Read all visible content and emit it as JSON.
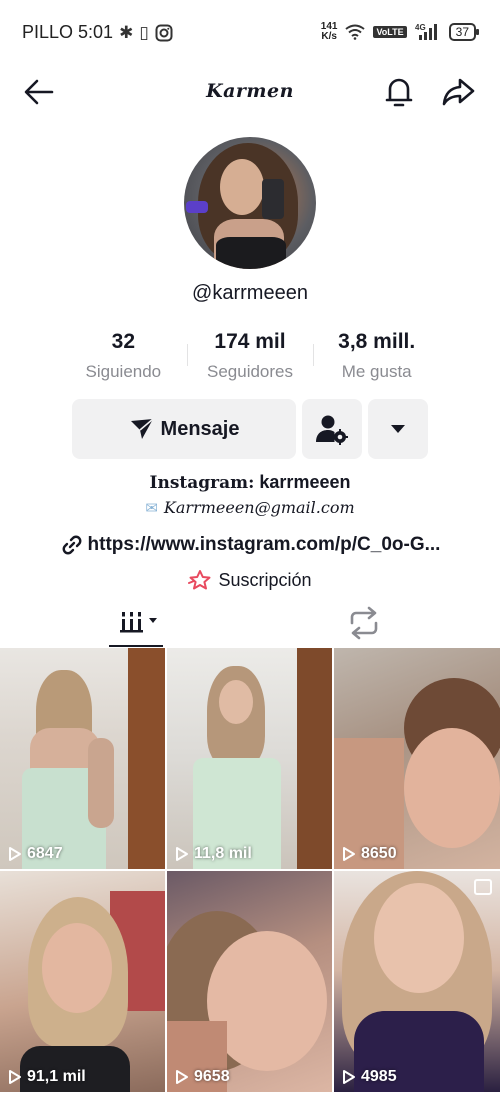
{
  "status_bar": {
    "carrier_time": "PILLO 5:01",
    "net_speed_value": "141",
    "net_speed_unit": "K/s",
    "volte": "VoLTE",
    "network": "4G",
    "battery": "37"
  },
  "header": {
    "title": "Karmen"
  },
  "profile": {
    "username": "@karrmeeen"
  },
  "stats": [
    {
      "value": "32",
      "label": "Siguiendo"
    },
    {
      "value": "174 mil",
      "label": "Seguidores"
    },
    {
      "value": "3,8 mill.",
      "label": "Me gusta"
    }
  ],
  "actions": {
    "message_label": "Mensaje"
  },
  "bio": {
    "instagram_label": "Instagram:",
    "instagram_handle": "karrmeeen",
    "email": "Karrmeeen@gmail.com",
    "link": "https://www.instagram.com/p/C_0o-G...",
    "subscription": "Suscripción"
  },
  "videos": [
    {
      "views": "6847"
    },
    {
      "views": "11,8 mil"
    },
    {
      "views": "8650"
    },
    {
      "views": "91,1 mil"
    },
    {
      "views": "9658"
    },
    {
      "views": "4985"
    }
  ],
  "colors": {
    "text": "#161823",
    "secondary_text": "#8a8b91",
    "button_bg": "#f1f1f2",
    "subscription_icon": "#e84a5f"
  }
}
